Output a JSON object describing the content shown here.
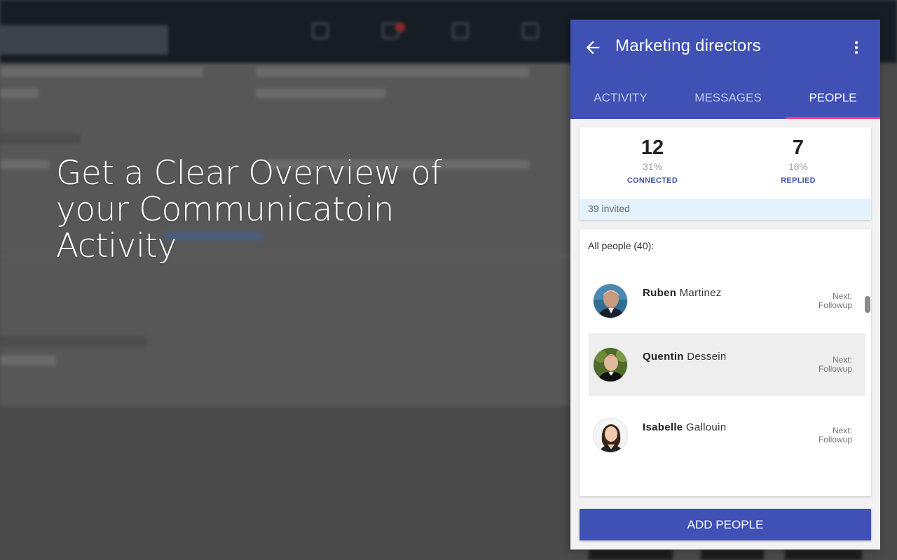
{
  "caption": {
    "line1": "Get a Clear Overview of",
    "line2": "your Communicatoin",
    "line3": "Activity"
  },
  "panel": {
    "title": "Marketing directors",
    "tabs": [
      {
        "label": "ACTIVITY",
        "active": false
      },
      {
        "label": "MESSAGES",
        "active": false
      },
      {
        "label": "PEOPLE",
        "active": true
      }
    ],
    "stats": [
      {
        "value": "12",
        "percent": "31%",
        "label": "CONNECTED"
      },
      {
        "value": "7",
        "percent": "18%",
        "label": "REPLIED"
      }
    ],
    "invited": "39 invited",
    "people_heading": "All people (40):",
    "people": [
      {
        "first": "Ruben",
        "last": "Martinez",
        "next_label": "Next:",
        "next_value": "Followup"
      },
      {
        "first": "Quentin",
        "last": "Dessein",
        "next_label": "Next:",
        "next_value": "Followup"
      },
      {
        "first": "Isabelle",
        "last": "Gallouin",
        "next_label": "Next:",
        "next_value": "Followup"
      }
    ],
    "add_button": "ADD PEOPLE"
  },
  "colors": {
    "primary": "#3f51b5",
    "tab_indicator": "#ff4081",
    "invited_bg": "#e3f2fd"
  },
  "icons": [
    "arrow-back-icon",
    "more-vert-icon"
  ]
}
